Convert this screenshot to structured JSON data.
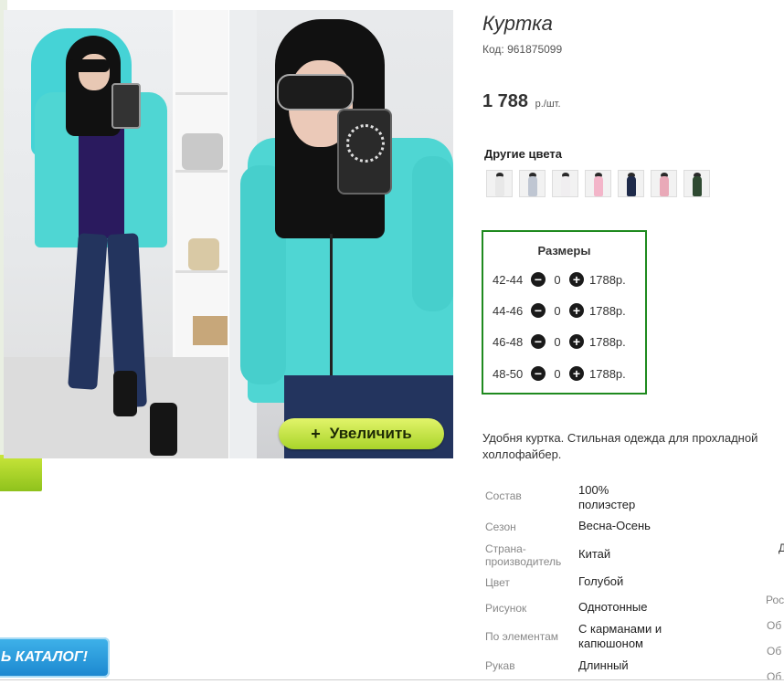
{
  "product": {
    "title": "Куртка",
    "code": "Код: 961875099",
    "price": "1 788",
    "price_unit": "р./шт."
  },
  "other_colors": {
    "label": "Другие цвета",
    "swatches": [
      {
        "color": "#e8e8e8",
        "name": "white-swatch"
      },
      {
        "color": "#bfc6d2",
        "name": "grey-swatch"
      },
      {
        "color": "#f0eef0",
        "name": "light-swatch"
      },
      {
        "color": "#f3b5c9",
        "name": "pink-swatch"
      },
      {
        "color": "#1e2a4a",
        "name": "navy-swatch"
      },
      {
        "color": "#e9a9b8",
        "name": "rose-swatch"
      },
      {
        "color": "#2f4a32",
        "name": "green-swatch"
      }
    ]
  },
  "sizes": {
    "title": "Размеры",
    "rows": [
      {
        "size": "42-44",
        "qty": "0",
        "price": "1788р."
      },
      {
        "size": "44-46",
        "qty": "0",
        "price": "1788р."
      },
      {
        "size": "46-48",
        "qty": "0",
        "price": "1788р."
      },
      {
        "size": "48-50",
        "qty": "0",
        "price": "1788р."
      }
    ],
    "minus_symbol": "−",
    "plus_symbol": "+"
  },
  "zoom_button": {
    "icon": "+",
    "label": "Увеличить"
  },
  "description": "Удобня куртка. Стильная одежда для прохладной холлофайбер.",
  "specs": [
    {
      "label": "Состав",
      "value": "100% полиэстер"
    },
    {
      "label": "Сезон",
      "value": "Весна-Осень"
    },
    {
      "label": "Страна-производитель",
      "value": "Китай"
    },
    {
      "label": "Цвет",
      "value": "Голубой"
    },
    {
      "label": "Рисунок",
      "value": "Однотонные"
    },
    {
      "label": "По элементам",
      "value": "С карманами и капюшоном"
    },
    {
      "label": "Рукав",
      "value": "Длинный"
    }
  ],
  "edge_texts": [
    "Рос",
    "Об",
    "Об",
    "Об"
  ],
  "edge_d": "Д",
  "catalog_button": "Ь КАТАЛОГ!",
  "colors": {
    "accent_green": "#1f8a1f",
    "zoom_button": "#c6e23e",
    "catalog_button": "#2a9be0",
    "jacket": "#4fd6d3"
  }
}
